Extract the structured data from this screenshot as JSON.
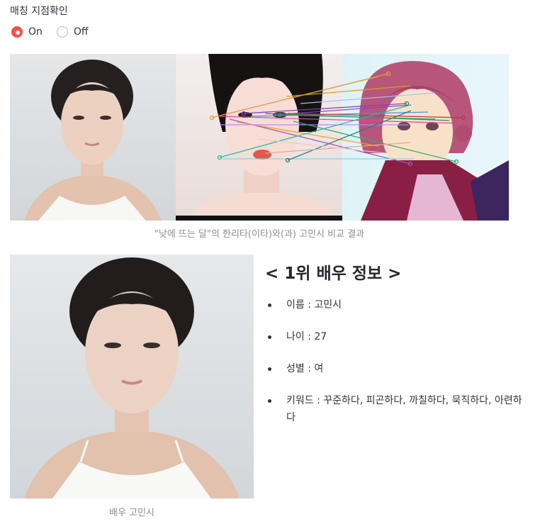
{
  "matching": {
    "label": "매칭 지점확인",
    "options": [
      "On",
      "Off"
    ],
    "selected": "On"
  },
  "comparison": {
    "caption": "\"낮에 뜨는 달\"의 한리타(이타)와(과) 고민시 비교 결과"
  },
  "actor": {
    "caption": "배우 고민시",
    "title": "< 1위 배우 정보 >",
    "name_line": "이름 : 고민시",
    "age_line": "나이 : 27",
    "gender_line": "성별 : 여",
    "keywords_line": "키워드 : 꾸준하다, 피곤하다, 까칠하다, 묵직하다, 아련하다"
  },
  "colors": {
    "accent": "#ff4b4b",
    "text": "#31333f",
    "caption": "#8a8d96"
  }
}
